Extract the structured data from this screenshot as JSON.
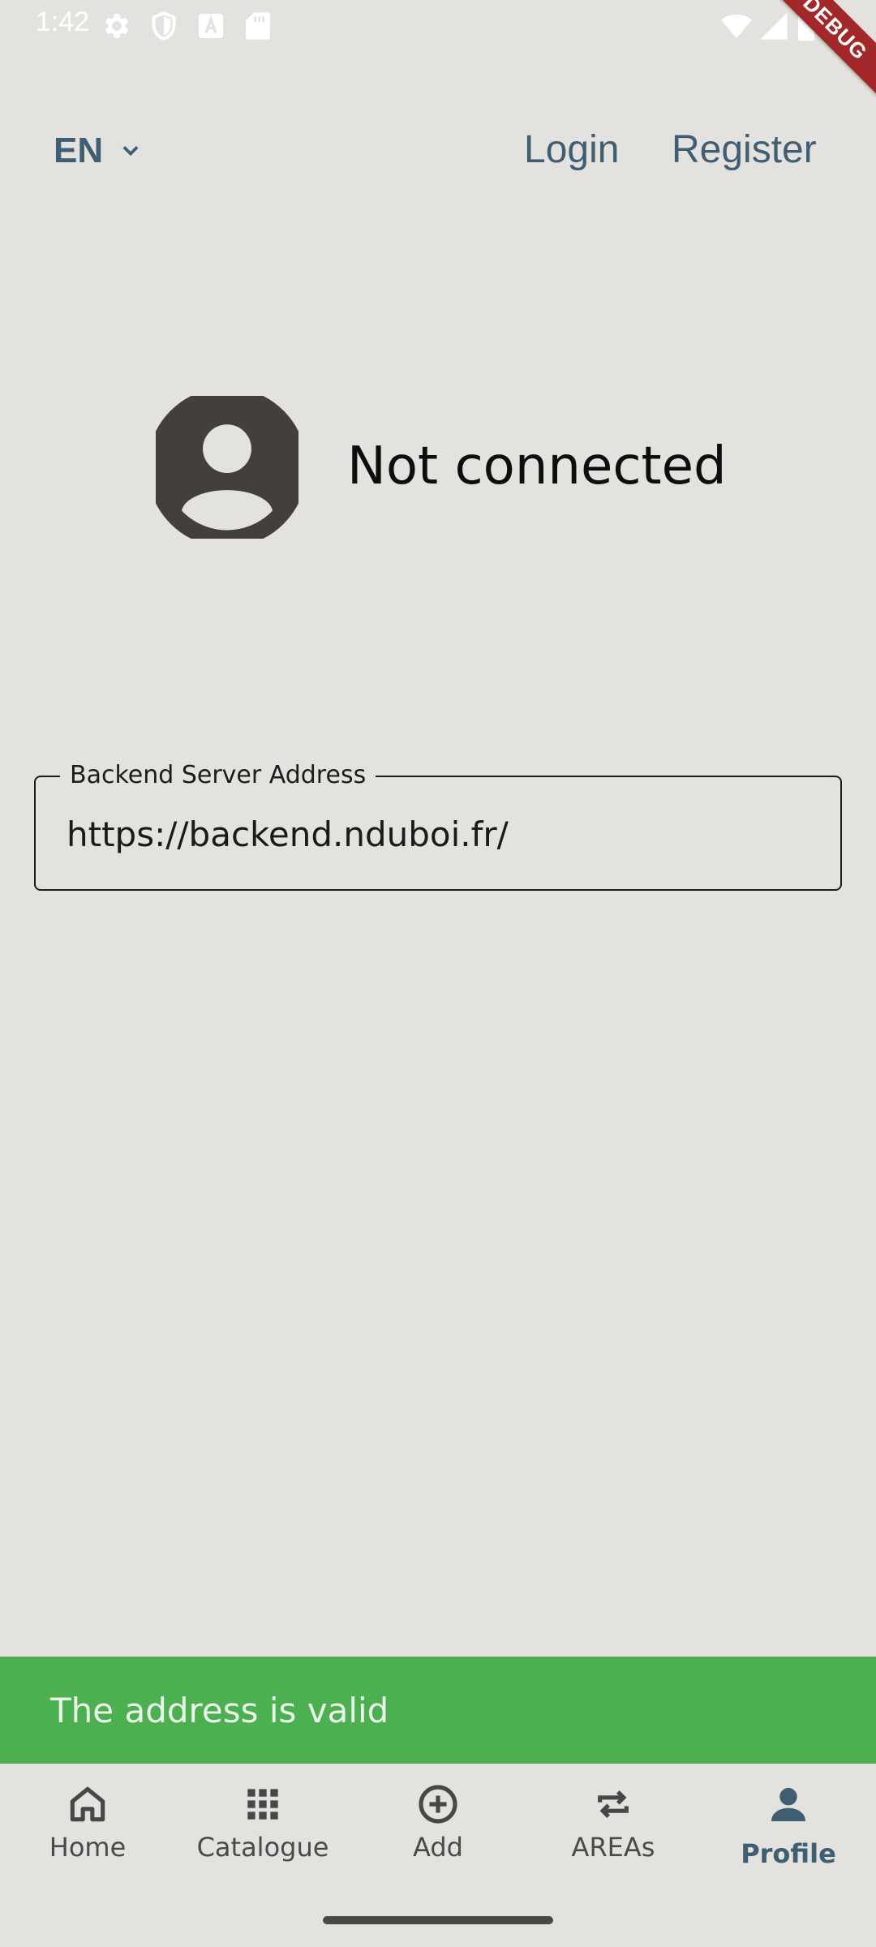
{
  "status_bar": {
    "time": "1:42",
    "icons": [
      "gear-icon",
      "shield-icon",
      "a-square-icon",
      "sd-card-icon",
      "wifi-icon",
      "signal-icon",
      "battery-icon"
    ]
  },
  "debug_banner": {
    "label": "DEBUG"
  },
  "header": {
    "language": "EN",
    "login_label": "Login",
    "register_label": "Register"
  },
  "profile": {
    "status_text": "Not connected"
  },
  "backend_field": {
    "label": "Backend Server Address",
    "value": "https://backend.nduboi.fr/"
  },
  "snackbar": {
    "message": "The address is valid",
    "color": "#4caf50"
  },
  "bottom_nav": {
    "items": [
      {
        "label": "Home",
        "icon": "home-icon"
      },
      {
        "label": "Catalogue",
        "icon": "grid-icon"
      },
      {
        "label": "Add",
        "icon": "add-circle-icon"
      },
      {
        "label": "AREAs",
        "icon": "repeat-icon"
      },
      {
        "label": "Profile",
        "icon": "person-icon",
        "active": true
      }
    ]
  },
  "colors": {
    "background": "#e3e2df",
    "accent": "#3f5e72",
    "debug": "#a3282a"
  }
}
